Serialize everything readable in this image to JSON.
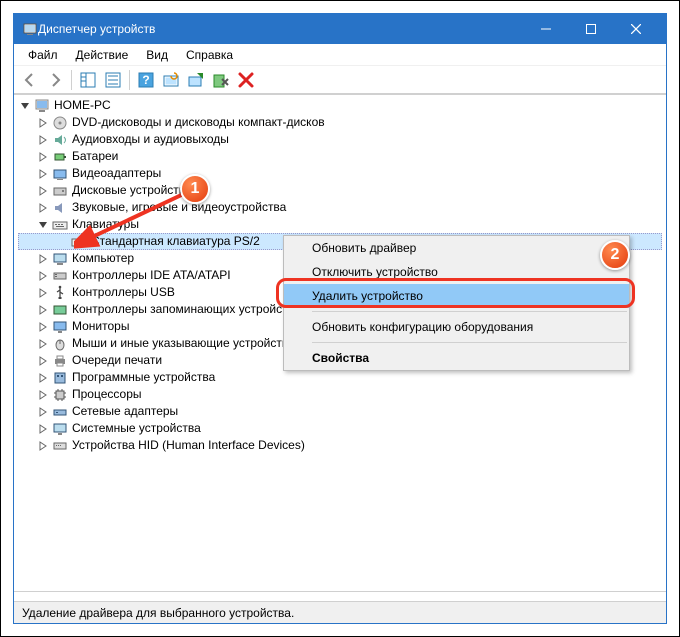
{
  "title": "Диспетчер устройств",
  "menu": {
    "file": "Файл",
    "action": "Действие",
    "view": "Вид",
    "help": "Справка"
  },
  "root": "HOME-PC",
  "nodes": {
    "dvd": "DVD-дисководы и дисководы компакт-дисков",
    "audio": "Аудиовходы и аудиовыходы",
    "batt": "Батареи",
    "video": "Видеоадаптеры",
    "disk": "Дисковые устройства",
    "sound": "Звуковые, игровые и видеоустройства",
    "kbd": "Клавиатуры",
    "kbd_item": "Стандартная клавиатура PS/2",
    "pc": "Компьютер",
    "ide": "Контроллеры IDE ATA/ATAPI",
    "usb": "Контроллеры USB",
    "storage": "Контроллеры запоминающих устройств",
    "monitor": "Мониторы",
    "mouse": "Мыши и иные указывающие устройства",
    "print": "Очереди печати",
    "soft": "Программные устройства",
    "cpu": "Процессоры",
    "net": "Сетевые адаптеры",
    "sys": "Системные устройства",
    "hid": "Устройства HID (Human Interface Devices)"
  },
  "ctx": {
    "update": "Обновить драйвер",
    "disable": "Отключить устройство",
    "remove": "Удалить устройство",
    "refresh": "Обновить конфигурацию оборудования",
    "props": "Свойства"
  },
  "badge1": "1",
  "badge2": "2",
  "status": "Удаление драйвера для выбранного устройства."
}
